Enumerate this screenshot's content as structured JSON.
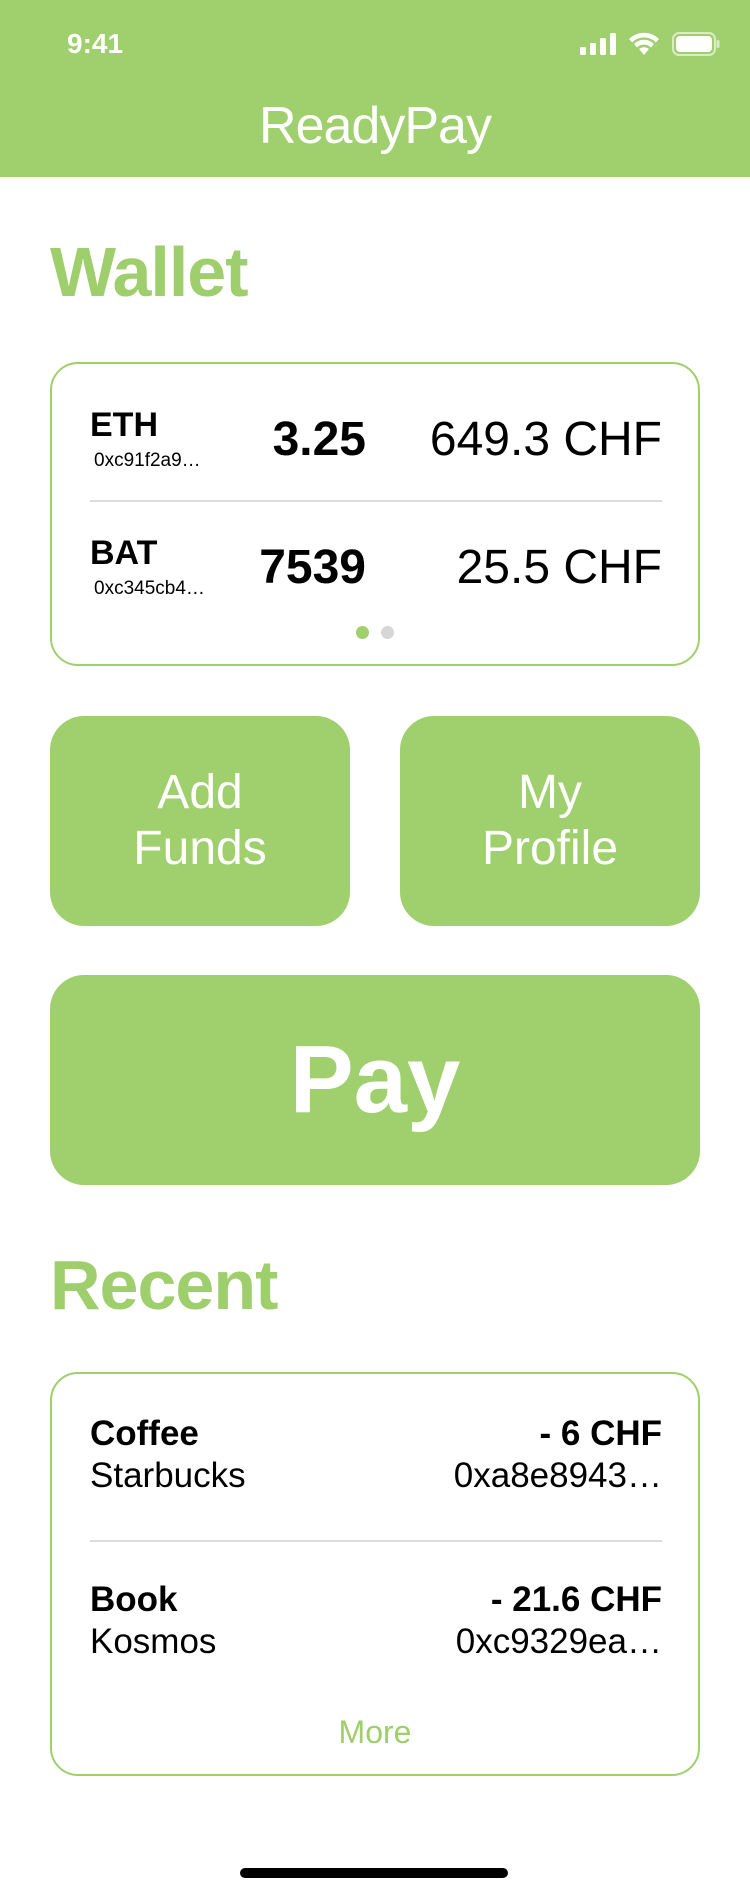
{
  "status_bar": {
    "time": "9:41"
  },
  "app": {
    "title": "ReadyPay"
  },
  "wallet": {
    "title": "Wallet",
    "assets": [
      {
        "symbol": "ETH",
        "address": "0xc91f2a9…",
        "amount": "3.25",
        "fiat": "649.3 CHF"
      },
      {
        "symbol": "BAT",
        "address": "0xc345cb4…",
        "amount": "7539",
        "fiat": "25.5 CHF"
      }
    ],
    "pages": 2,
    "active_page": 1
  },
  "actions": {
    "add_funds_line1": "Add",
    "add_funds_line2": "Funds",
    "my_profile_line1": "My",
    "my_profile_line2": "Profile",
    "pay": "Pay"
  },
  "recent": {
    "title": "Recent",
    "transactions": [
      {
        "title": "Coffee",
        "merchant": "Starbucks",
        "amount": "- 6 CHF",
        "hash": "0xa8e8943…"
      },
      {
        "title": "Book",
        "merchant": "Kosmos",
        "amount": "- 21.6 CHF",
        "hash": "0xc9329ea…"
      }
    ],
    "more_label": "More"
  },
  "colors": {
    "accent": "#a0cf6e",
    "divider": "#dcdcdc",
    "text": "#000000"
  },
  "icons": [
    "signal-icon",
    "wifi-icon",
    "battery-icon"
  ]
}
